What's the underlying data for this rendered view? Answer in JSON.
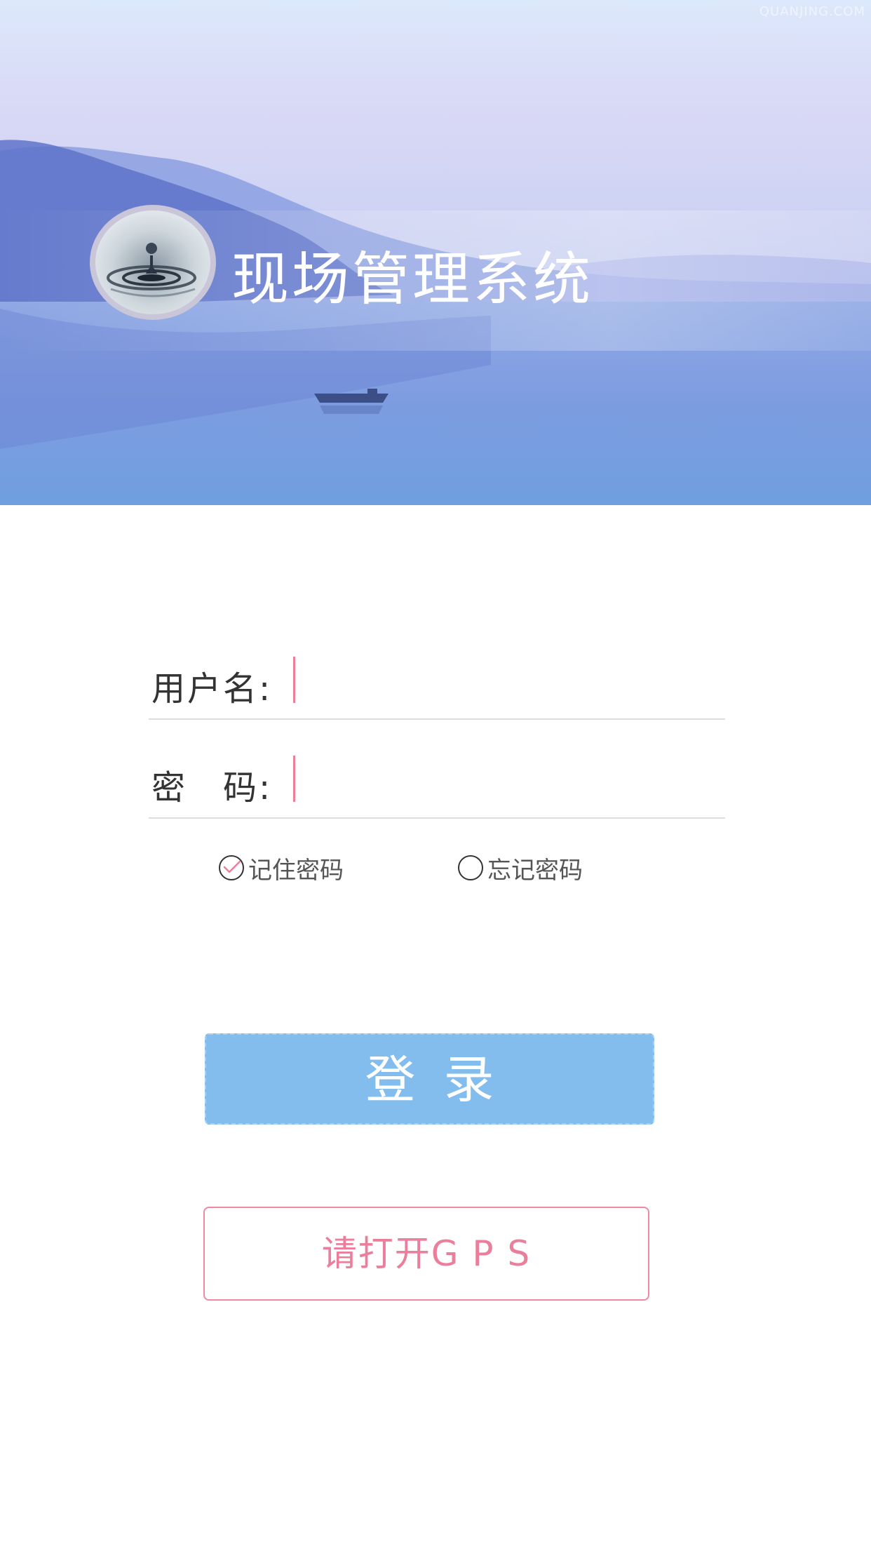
{
  "header": {
    "watermark": "QUANJING.COM",
    "app_title": "现场管理系统"
  },
  "form": {
    "username_label": "用户名:",
    "username_value": "",
    "password_label": "密　码:",
    "password_value": ""
  },
  "options": {
    "remember_label": "记住密码",
    "remember_checked": true,
    "forgot_label": "忘记密码",
    "forgot_checked": false
  },
  "buttons": {
    "login_label": "登录",
    "gps_label": "请打开G P S"
  },
  "colors": {
    "caret": "#ee7f99",
    "login_bg": "#82bded",
    "gps_accent": "#ea7e9b"
  }
}
